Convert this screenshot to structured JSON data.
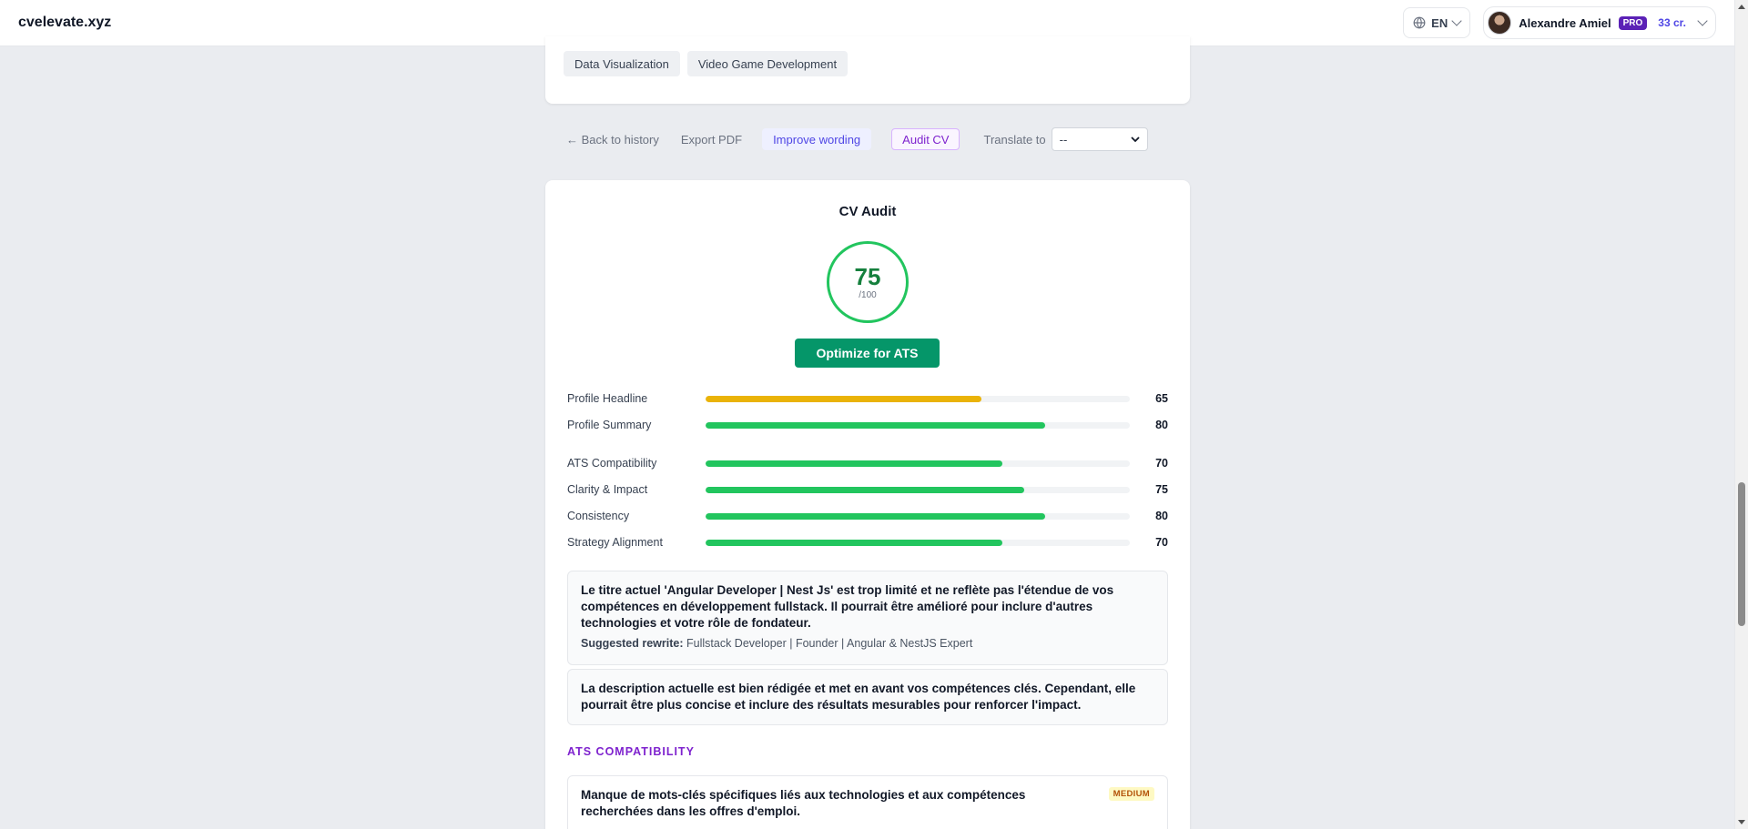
{
  "header": {
    "brand": "cvelevate.xyz",
    "language": "EN",
    "user_name": "Alexandre Amiel",
    "plan_badge": "PRO",
    "credits": "33 cr."
  },
  "skills_tags": [
    "Data Visualization",
    "Video Game Development"
  ],
  "actions": {
    "back": "← Back to history",
    "export_pdf": "Export PDF",
    "improve_wording": "Improve wording",
    "audit_cv": "Audit CV",
    "translate_label": "Translate to",
    "translate_selected": "--"
  },
  "audit": {
    "title": "CV Audit",
    "score": "75",
    "score_max": "/100",
    "optimize_button": "Optimize for ATS",
    "bars": [
      {
        "label": "Profile Headline",
        "value": 65,
        "display": "65",
        "color": "#eab308"
      },
      {
        "label": "Profile Summary",
        "value": 80,
        "display": "80",
        "color": "#22c55e"
      },
      {
        "label": "ATS Compatibility",
        "value": 70,
        "display": "70",
        "color": "#22c55e"
      },
      {
        "label": "Clarity & Impact",
        "value": 75,
        "display": "75",
        "color": "#22c55e"
      },
      {
        "label": "Consistency",
        "value": 80,
        "display": "80",
        "color": "#22c55e"
      },
      {
        "label": "Strategy Alignment",
        "value": 70,
        "display": "70",
        "color": "#22c55e"
      }
    ],
    "headline_note": "Le titre actuel 'Angular Developer | Nest Js' est trop limité et ne reflète pas l'étendue de vos compétences en développement fullstack. Il pourrait être amélioré pour inclure d'autres technologies et votre rôle de fondateur.",
    "suggested_label": "Suggested rewrite:",
    "suggested_value": "Fullstack Developer | Founder | Angular & NestJS Expert",
    "summary_note": "La description actuelle est bien rédigée et met en avant vos compétences clés. Cependant, elle pourrait être plus concise et inclure des résultats mesurables pour renforcer l'impact.",
    "ats_heading": "ATS COMPATIBILITY",
    "ats_issue": "Manque de mots-clés spécifiques liés aux technologies et aux compétences recherchées dans les offres d'emploi.",
    "ats_severity": "MEDIUM"
  }
}
